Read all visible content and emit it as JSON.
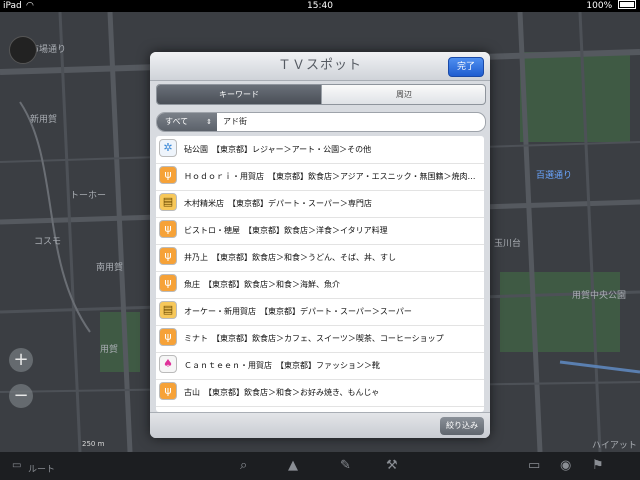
{
  "statusbar": {
    "device": "iPad",
    "time": "15:40",
    "battery": "100%"
  },
  "map": {
    "labels": [
      {
        "text": "市場通り",
        "color": "#a9adb3"
      },
      {
        "text": "百選通り",
        "color": "#6aa5ff"
      },
      {
        "text": "新用賀",
        "color": "#a9adb3"
      },
      {
        "text": "トーホー",
        "color": "#a9adb3"
      },
      {
        "text": "コスモ",
        "color": "#a9adb3"
      },
      {
        "text": "南用賀",
        "color": "#a9adb3"
      },
      {
        "text": "用賀",
        "color": "#a9adb3"
      },
      {
        "text": "玉川台",
        "color": "#a9adb3"
      },
      {
        "text": "用賀中央公園",
        "color": "#a9adb3"
      },
      {
        "text": "ハイアット",
        "color": "#a9adb3"
      },
      {
        "text": "250 m",
        "color": "#d8d8d8"
      }
    ]
  },
  "dialog": {
    "title": "ＴＶスポット",
    "done_label": "完了",
    "tabs": [
      "キーワード",
      "周辺"
    ],
    "search": {
      "scope_label": "すべて",
      "query": "アド街"
    },
    "items": [
      {
        "icon": "leisure",
        "text": "砧公園　【東京都】レジャー＞アート・公園＞その他"
      },
      {
        "icon": "food",
        "text": "Ｈｏｄｏｒｉ・用賀店　【東京都】飲食店＞アジア・エスニック・無国籍＞焼肉…"
      },
      {
        "icon": "dept",
        "text": "木村精米店　【東京都】デパート・スーパー＞専門店"
      },
      {
        "icon": "food",
        "text": "ビストロ・穂屋　【東京都】飲食店＞洋食＞イタリア料理"
      },
      {
        "icon": "food",
        "text": "井乃上　【東京都】飲食店＞和食＞うどん、そば、丼、すし"
      },
      {
        "icon": "food",
        "text": "魚庄　【東京都】飲食店＞和食＞海鮮、魚介"
      },
      {
        "icon": "dept",
        "text": "オーケー・新用賀店　【東京都】デパート・スーパー＞スーパー"
      },
      {
        "icon": "food",
        "text": "ミナト　【東京都】飲食店＞カフェ、スイーツ＞喫茶、コーヒーショップ"
      },
      {
        "icon": "fashion",
        "text": "Ｃａｎｔｅｅｎ・用賀店　【東京都】ファッション＞靴"
      },
      {
        "icon": "food",
        "text": "古山　【東京都】飲食店＞和食＞お好み焼き、もんじゃ"
      }
    ],
    "narrow_label": "絞り込み"
  },
  "toolbar": {
    "left_label": "ルート"
  },
  "icons": {
    "leisure": "leisure-icon",
    "food": "restaurant-icon",
    "dept": "shopping-cart-icon",
    "fashion": "clothing-icon"
  }
}
